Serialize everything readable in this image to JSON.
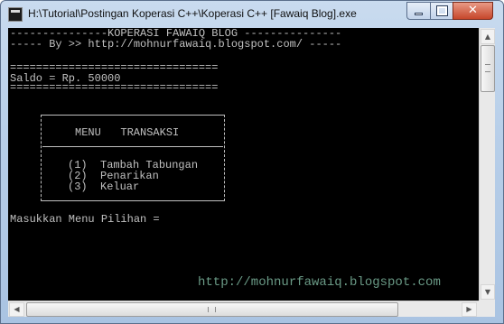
{
  "window": {
    "title": "H:\\Tutorial\\Postingan Koperasi C++\\Koperasi C++ [Fawaiq Blog].exe",
    "icon": "console-app-icon",
    "controls": {
      "minimize_icon": "minimize-icon",
      "maximize_icon": "maximize-icon",
      "close_icon": "close-icon",
      "close_glyph": "✕"
    }
  },
  "console": {
    "header_line1": "---------------KOPERASI FAWAIQ BLOG ---------------",
    "header_line2": "----- By >> http://mohnurfawaiq.blogspot.com/ -----",
    "rule_top": "================================",
    "saldo_line": "Saldo = Rp. 50000",
    "rule_bottom": "================================",
    "menu": {
      "title": "MENU   TRANSAKSI",
      "items": [
        "(1)  Tambah Tabungan",
        "(2)  Penarikan",
        "(3)  Keluar"
      ]
    },
    "prompt": "Masukkan Menu Pilihan = ",
    "watermark": "http://mohnurfawaiq.blogspot.com"
  },
  "scrollbars": {
    "up_arrow": "▲",
    "down_arrow": "▼",
    "left_arrow": "◀",
    "right_arrow": "▶"
  },
  "colors": {
    "console_bg": "#000000",
    "console_text": "#c0c0c0",
    "watermark": "#6a9a86",
    "close_button": "#c6462a"
  }
}
